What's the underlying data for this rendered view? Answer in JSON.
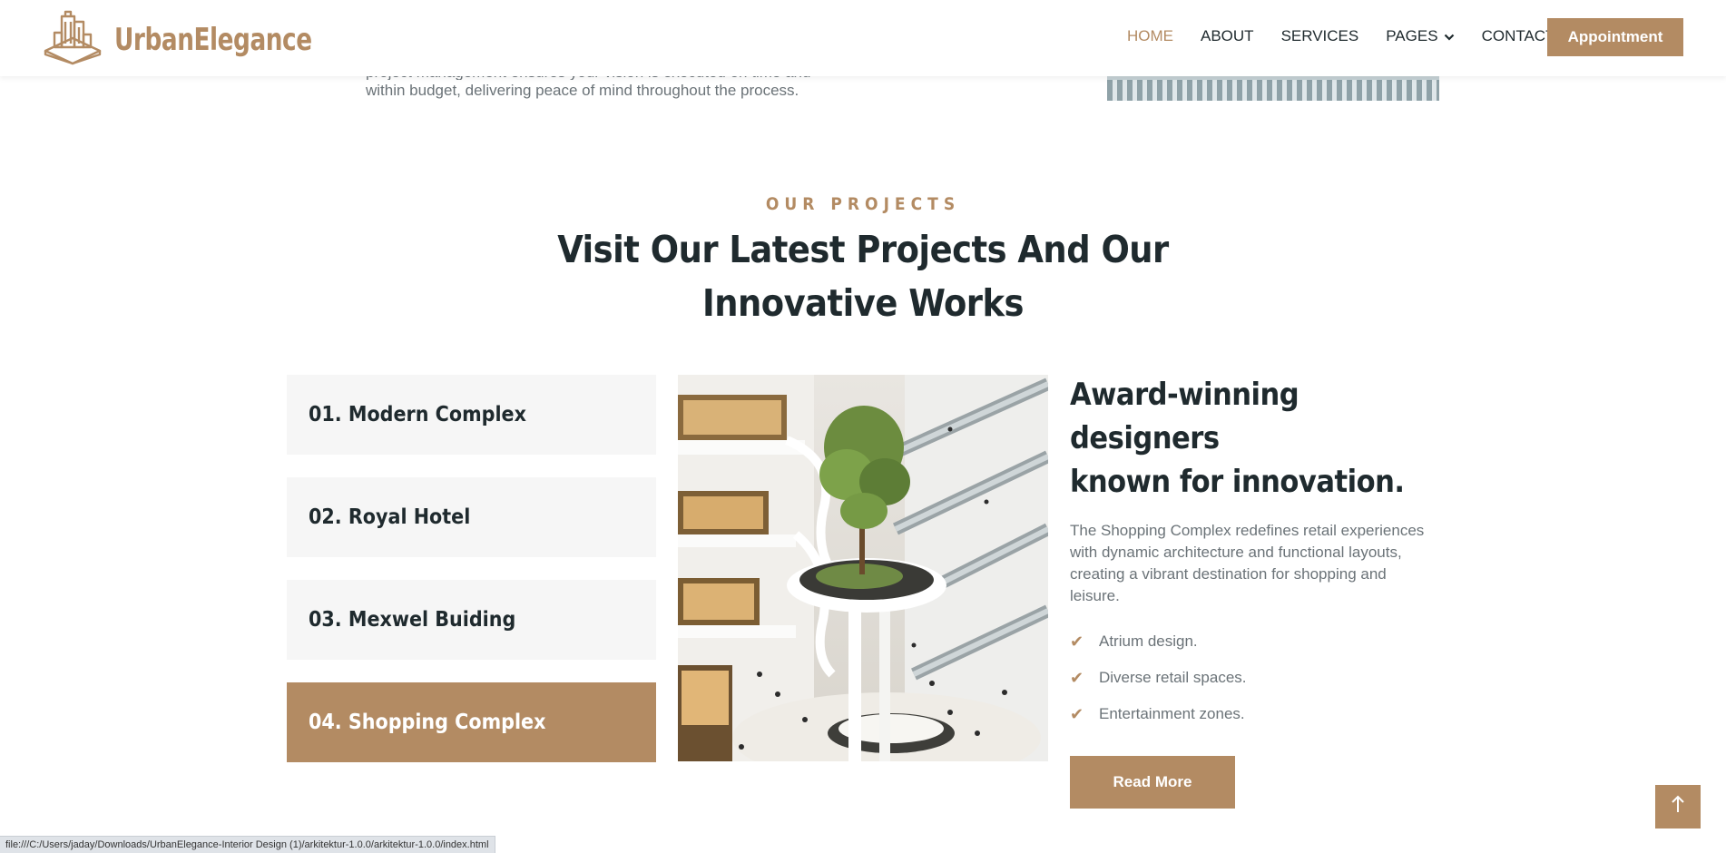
{
  "header": {
    "logo_text": "UrbanElegance",
    "nav": [
      {
        "label": "HOME",
        "active": true
      },
      {
        "label": "ABOUT"
      },
      {
        "label": "SERVICES"
      },
      {
        "label": "PAGES"
      },
      {
        "label": "CONTACT"
      }
    ],
    "cta_label": "Appointment"
  },
  "prev_section": {
    "text_line1": "project management ensures your vision is executed on time and",
    "text_line2": "within budget, delivering peace of mind throughout the process."
  },
  "projects": {
    "eyebrow": "OUR PROJECTS",
    "heading_line1": "Visit Our Latest Projects And Our",
    "heading_line2": "Innovative Works",
    "tabs": [
      {
        "label": "01. Modern Complex"
      },
      {
        "label": "02. Royal Hotel"
      },
      {
        "label": "03. Mexwel Buiding"
      },
      {
        "label": "04. Shopping Complex",
        "active": true
      }
    ],
    "detail": {
      "title_line1": "Award-winning designers",
      "title_line2": "known for innovation.",
      "description": "The Shopping Complex redefines retail experiences with dynamic architecture and functional layouts, creating a vibrant destination for shopping and leisure.",
      "features": [
        "Atrium design.",
        "Diverse retail spaces.",
        "Entertainment zones."
      ],
      "button_label": "Read More"
    }
  },
  "status_bar": {
    "url": "file:///C:/Users/jaday/Downloads/UrbanElegance-Interior Design (1)/arkitektur-1.0.0/arkitektur-1.0.0/index.html"
  },
  "colors": {
    "accent": "#b38b63",
    "heading": "#1f2a2e",
    "body_text": "#6b7378",
    "tab_bg": "#f6f6f6"
  },
  "icons": {
    "logo": "building-icon",
    "pages_dropdown": "chevron-down-icon",
    "feature_bullet": "check-icon",
    "back_to_top": "arrow-up-icon"
  }
}
